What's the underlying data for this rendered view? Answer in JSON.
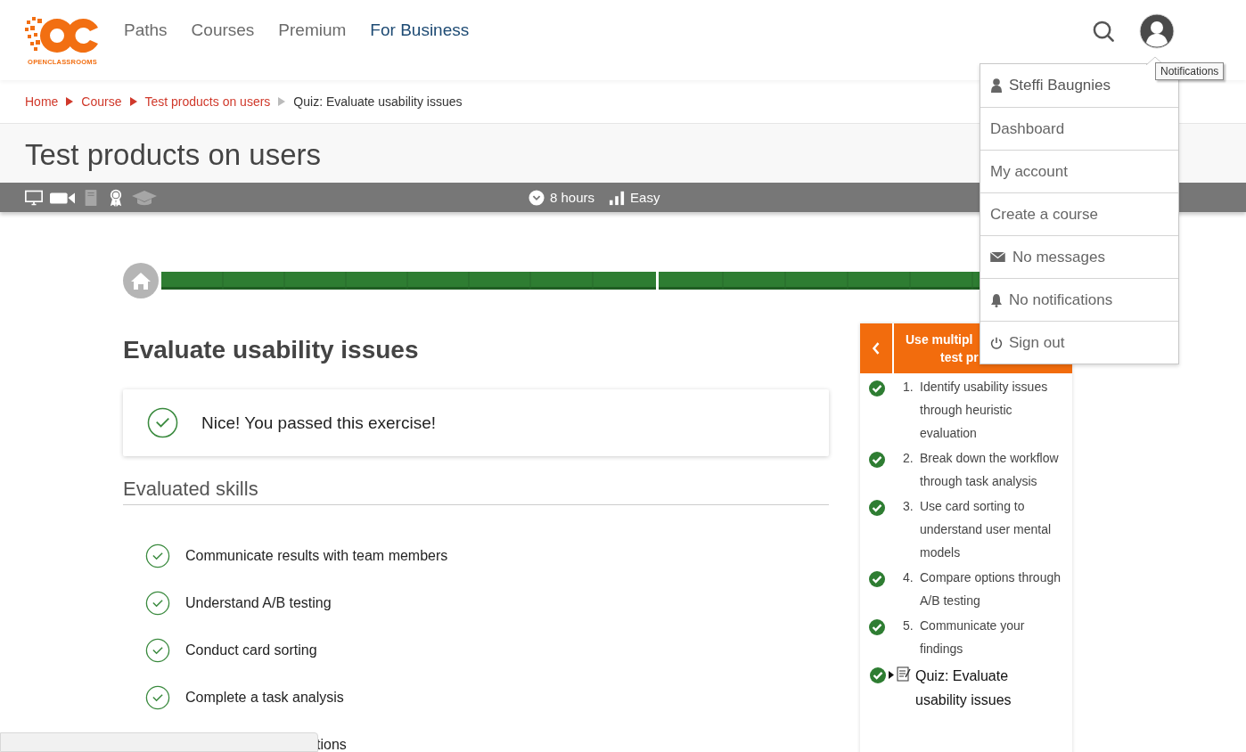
{
  "header": {
    "logo_text": "OPENCLASSROOMS",
    "nav": [
      {
        "label": "Paths",
        "selected": false
      },
      {
        "label": "Courses",
        "selected": false
      },
      {
        "label": "Premium",
        "selected": false
      },
      {
        "label": "For Business",
        "selected": true
      }
    ]
  },
  "breadcrumb": [
    {
      "label": "Home",
      "kind": "link"
    },
    {
      "label": "Course",
      "kind": "link"
    },
    {
      "label": "Test products on users",
      "kind": "link"
    },
    {
      "label": "Quiz: Evaluate usability issues",
      "kind": "current"
    }
  ],
  "course": {
    "title": "Test products on users",
    "features": [
      {
        "kind": "screen",
        "available": true
      },
      {
        "kind": "video",
        "available": true
      },
      {
        "kind": "book",
        "available": false
      },
      {
        "kind": "award",
        "available": true
      },
      {
        "kind": "cap",
        "available": false
      }
    ],
    "duration": "8 hours",
    "difficulty": "Easy"
  },
  "quiz": {
    "title": "Evaluate usability issues",
    "result": "Nice! You passed this exercise!",
    "skills_heading": "Evaluated skills",
    "skills": [
      {
        "label": "Communicate results with team members",
        "kind": "full"
      },
      {
        "label": "Understand A/B testing",
        "kind": "full"
      },
      {
        "label": "Conduct card sorting",
        "kind": "full"
      },
      {
        "label": "Complete a task analysis",
        "kind": "full"
      },
      {
        "label": "tions",
        "kind": "covered"
      }
    ]
  },
  "chapter_panel": {
    "title_lines": [
      "Use multipl",
      "test pr"
    ],
    "items": [
      {
        "number": "1.",
        "label": "Identify usability issues through heuristic evaluation",
        "kind": "chapter",
        "done": true
      },
      {
        "number": "2.",
        "label": "Break down the workflow through task analysis",
        "kind": "chapter",
        "done": true
      },
      {
        "number": "3.",
        "label": "Use card sorting to understand user mental models",
        "kind": "chapter",
        "done": true
      },
      {
        "number": "4.",
        "label": "Compare options through A/B testing",
        "kind": "chapter",
        "done": true
      },
      {
        "number": "5.",
        "label": "Communicate your findings",
        "kind": "chapter",
        "done": true
      },
      {
        "label": "Quiz: Evaluate usability issues",
        "kind": "quiz",
        "done": true
      }
    ]
  },
  "user_menu": {
    "items": [
      {
        "label": "Steffi Baugnies",
        "kind": "user"
      },
      {
        "label": "Dashboard",
        "kind": "plain"
      },
      {
        "label": "My account",
        "kind": "plain"
      },
      {
        "label": "Create a course",
        "kind": "plain"
      },
      {
        "label": "No messages",
        "kind": "messages"
      },
      {
        "label": "No notifications",
        "kind": "notifications"
      },
      {
        "label": "Sign out",
        "kind": "signout"
      }
    ]
  },
  "tooltip": "Notifications"
}
